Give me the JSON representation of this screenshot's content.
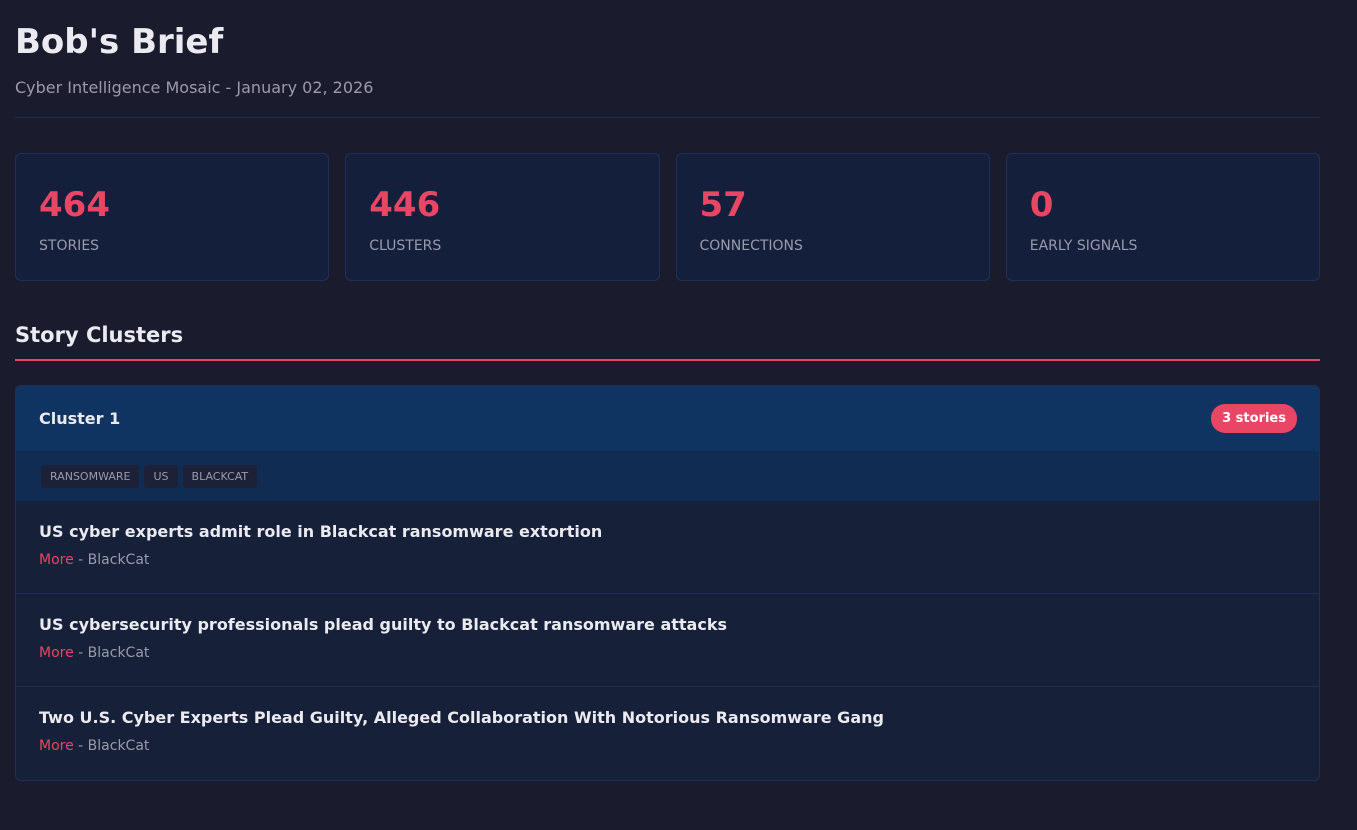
{
  "header": {
    "title": "Bob's Brief",
    "subtitle": "Cyber Intelligence Mosaic - January 02, 2026"
  },
  "stats": [
    {
      "value": "464",
      "label": "STORIES"
    },
    {
      "value": "446",
      "label": "CLUSTERS"
    },
    {
      "value": "57",
      "label": "CONNECTIONS"
    },
    {
      "value": "0",
      "label": "EARLY SIGNALS"
    }
  ],
  "section": {
    "title": "Story Clusters"
  },
  "clusters": [
    {
      "name": "Cluster 1",
      "badge": "3 stories",
      "tags": [
        "RANSOMWARE",
        "US",
        "BLACKCAT"
      ],
      "stories": [
        {
          "title": "US cyber experts admit role in Blackcat ransomware extortion",
          "more": "More",
          "separator": " - ",
          "source": "BlackCat"
        },
        {
          "title": "US cybersecurity professionals plead guilty to Blackcat ransomware attacks",
          "more": "More",
          "separator": " - ",
          "source": "BlackCat"
        },
        {
          "title": "Two U.S. Cyber Experts Plead Guilty, Alleged Collaboration With Notorious Ransomware Gang",
          "more": "More",
          "separator": " - ",
          "source": "BlackCat"
        }
      ]
    }
  ],
  "colors": {
    "background": "#1b1b2e",
    "accent": "#e94564",
    "card": "#141f3c",
    "cluster_header": "#0f3461"
  }
}
